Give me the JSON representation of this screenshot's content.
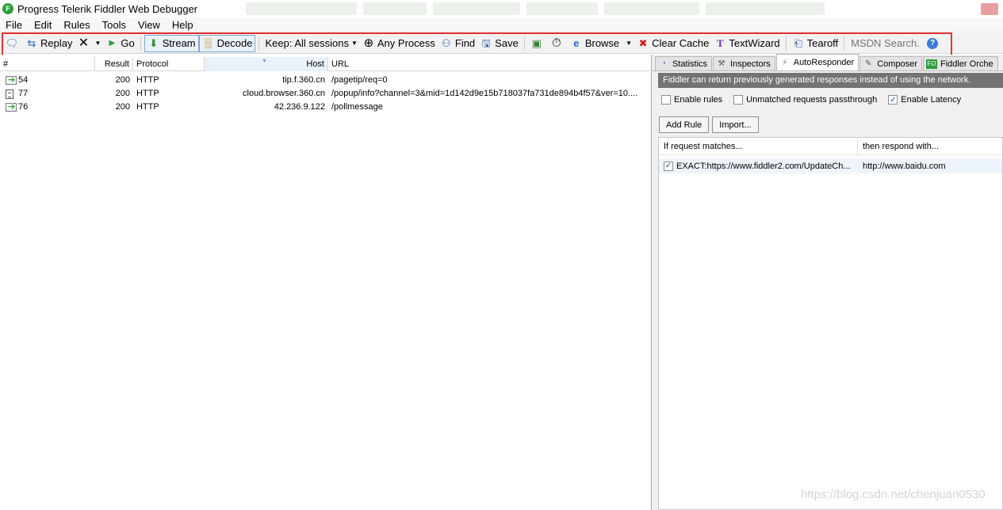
{
  "window": {
    "title": "Progress Telerik Fiddler Web Debugger"
  },
  "menu": [
    "File",
    "Edit",
    "Rules",
    "Tools",
    "View",
    "Help"
  ],
  "toolbar": {
    "replay": "Replay",
    "go": "Go",
    "stream": "Stream",
    "decode": "Decode",
    "keep": "Keep: All sessions",
    "any_process": "Any Process",
    "find": "Find",
    "save": "Save",
    "browse": "Browse",
    "clear_cache": "Clear Cache",
    "textwizard": "TextWizard",
    "tearoff": "Tearoff",
    "msdn_placeholder": "MSDN Search..."
  },
  "sessions": {
    "columns": [
      "#",
      "Result",
      "Protocol",
      "Host",
      "URL"
    ],
    "rows": [
      {
        "num": "54",
        "result": "200",
        "protocol": "HTTP",
        "host": "tip.f.360.cn",
        "url": "/pagetip/req=0",
        "icon": "arrow-icon"
      },
      {
        "num": "77",
        "result": "200",
        "protocol": "HTTP",
        "host": "cloud.browser.360.cn",
        "url": "/popup/info?channel=3&mid=1d142d9e15b718037fa731de894b4f57&ver=10....",
        "icon": "document-icon"
      },
      {
        "num": "76",
        "result": "200",
        "protocol": "HTTP",
        "host": "42.236.9.122",
        "url": "/pollmessage",
        "icon": "arrow-icon"
      }
    ]
  },
  "right_panel": {
    "tabs": [
      "Statistics",
      "Inspectors",
      "AutoResponder",
      "Composer",
      "Fiddler Orche"
    ],
    "info": "Fiddler can return previously generated responses instead of using the network.",
    "options": {
      "enable_rules": "Enable rules",
      "unmatched": "Unmatched requests passthrough",
      "enable_latency": "Enable Latency"
    },
    "buttons": {
      "add_rule": "Add Rule",
      "import": "Import..."
    },
    "rules_columns": {
      "match": "If request matches...",
      "respond": "then respond with..."
    },
    "rules": [
      {
        "match": "EXACT:https://www.fiddler2.com/UpdateCh...",
        "respond": "http://www.baidu.com"
      }
    ]
  },
  "watermark": "https://blog.csdn.net/chenjuan0530",
  "colors": {
    "highlight": "#e53333",
    "info_bar": "#737373",
    "logo": "#2e9d3a"
  }
}
